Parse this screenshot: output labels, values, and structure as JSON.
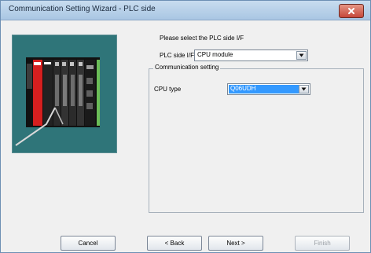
{
  "window": {
    "title": "Communication Setting Wizard - PLC side"
  },
  "icons": {
    "close": "close-icon",
    "dropdown": "chevron-down-icon"
  },
  "wizard": {
    "prompt": "Please select the PLC side I/F",
    "plc_side_if_label": "PLC side I/F",
    "plc_side_if_value": "CPU module",
    "communication_setting_legend": "Communication setting",
    "cpu_type_label": "CPU type",
    "cpu_type_value": "Q06UDH"
  },
  "buttons": {
    "cancel": "Cancel",
    "back": "< Back",
    "next": "Next >",
    "finish": "Finish"
  },
  "colors": {
    "title_bar": "#b6d0eb",
    "graphic_background": "#2f7579",
    "selection_highlight": "#3399ff",
    "close_button": "#c94f42"
  }
}
